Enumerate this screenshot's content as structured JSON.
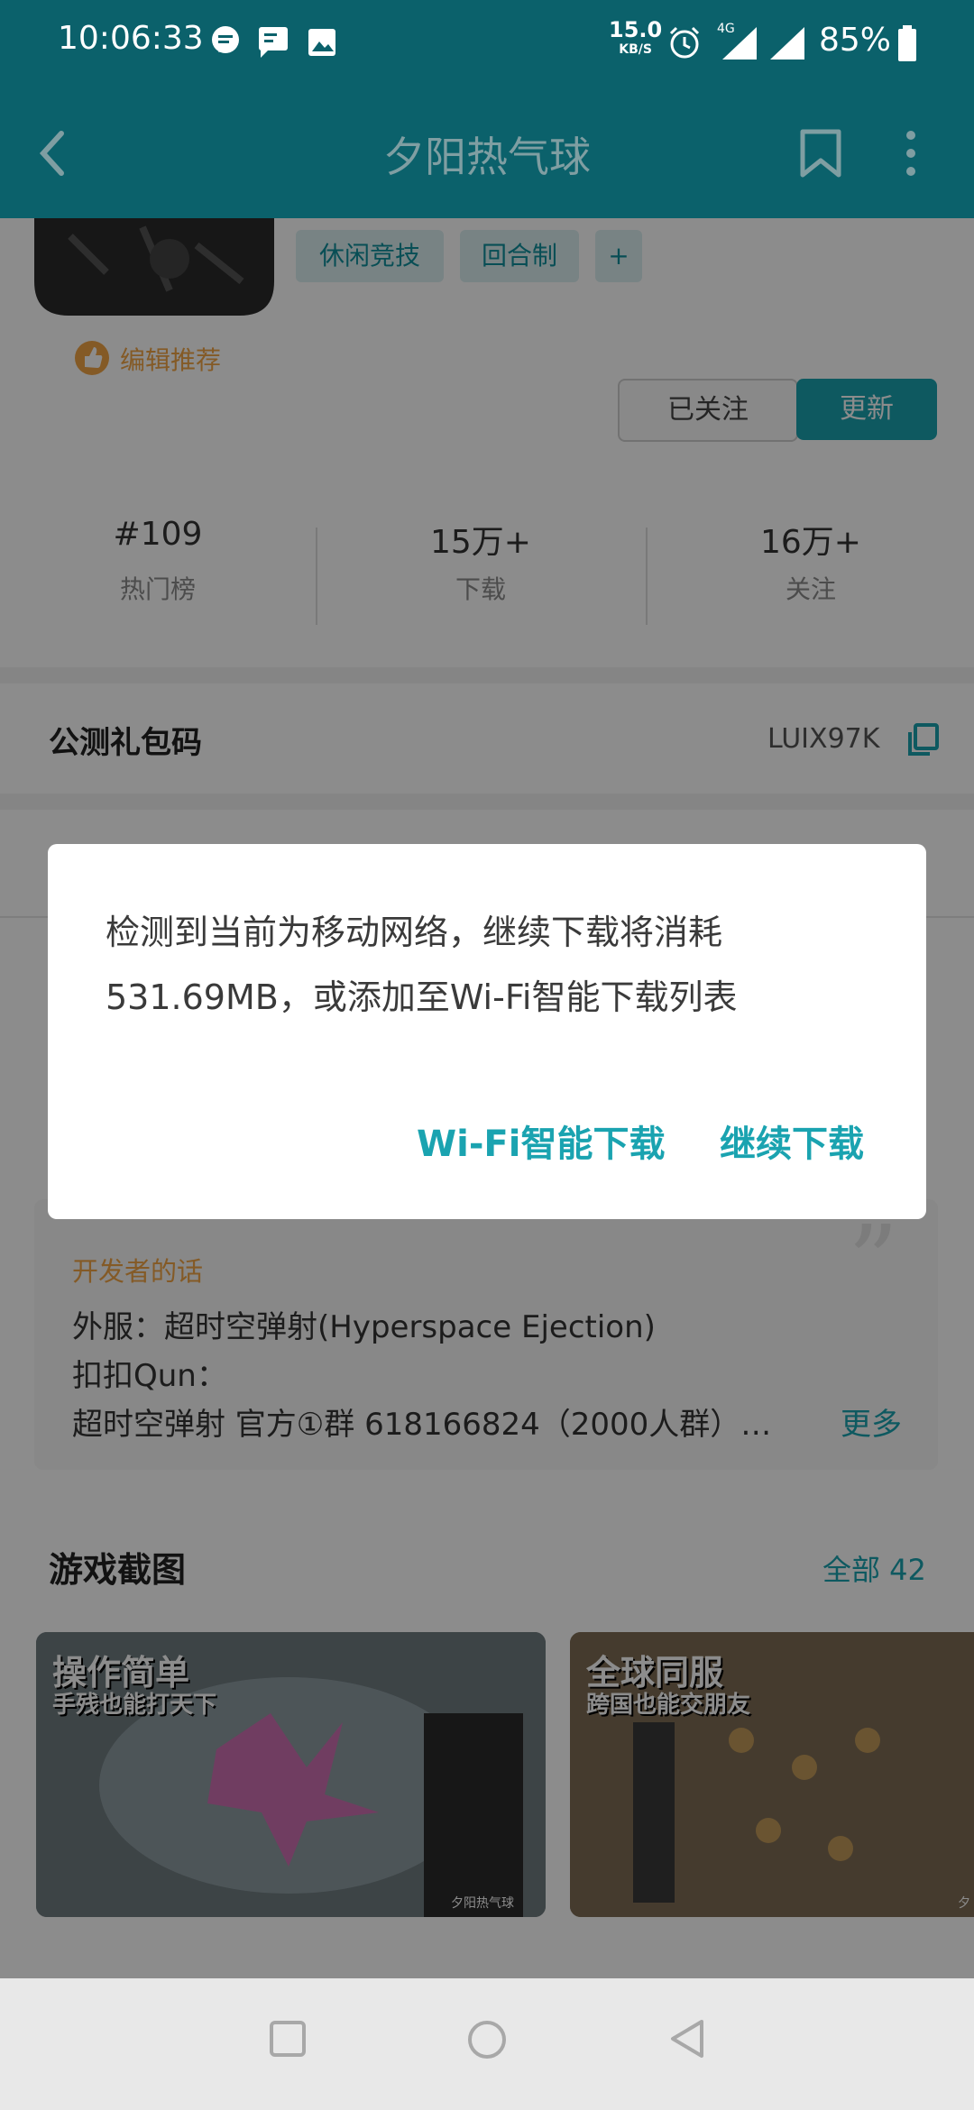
{
  "status_bar": {
    "time": "10:06:33",
    "net_speed": "15.0",
    "net_unit": "KB/S",
    "signal_label": "4G",
    "battery": "85%"
  },
  "app_bar": {
    "title": "夕阳热气球"
  },
  "game": {
    "tags": [
      "休闲竞技",
      "回合制",
      "+"
    ],
    "editor_pick": "编辑推荐",
    "followed_button": "已关注",
    "update_button": "更新",
    "stats": [
      {
        "value": "#109",
        "label": "热门榜"
      },
      {
        "value": "15万+",
        "label": "下载"
      },
      {
        "value": "16万+",
        "label": "关注"
      }
    ]
  },
  "gift_code": {
    "label": "公测礼包码",
    "code": "LUIX97K"
  },
  "developer": {
    "title": "开发者的话",
    "lines": [
      "外服：超时空弹射(Hyperspace Ejection)",
      "扣扣Qun：",
      "超时空弹射 官方①群 618166824（2000人群）…"
    ],
    "more": "更多"
  },
  "screenshots": {
    "title": "游戏截图",
    "all_link": "全部 42",
    "items": [
      {
        "caption_1": "操作简单",
        "caption_2": "手残也能打天下",
        "footer": "夕阳热气球"
      },
      {
        "caption_1": "全球同服",
        "caption_2": "跨国也能交朋友",
        "footer": "夕"
      }
    ]
  },
  "dialog": {
    "message": "检测到当前为移动网络，继续下载将消耗531.69MB，或添加至Wi-Fi智能下载列表",
    "wifi_button": "Wi-Fi智能下载",
    "continue_button": "继续下载"
  },
  "colors": {
    "primary": "#0b616b",
    "accent": "#1aa3b0",
    "orange": "#f0a445"
  }
}
